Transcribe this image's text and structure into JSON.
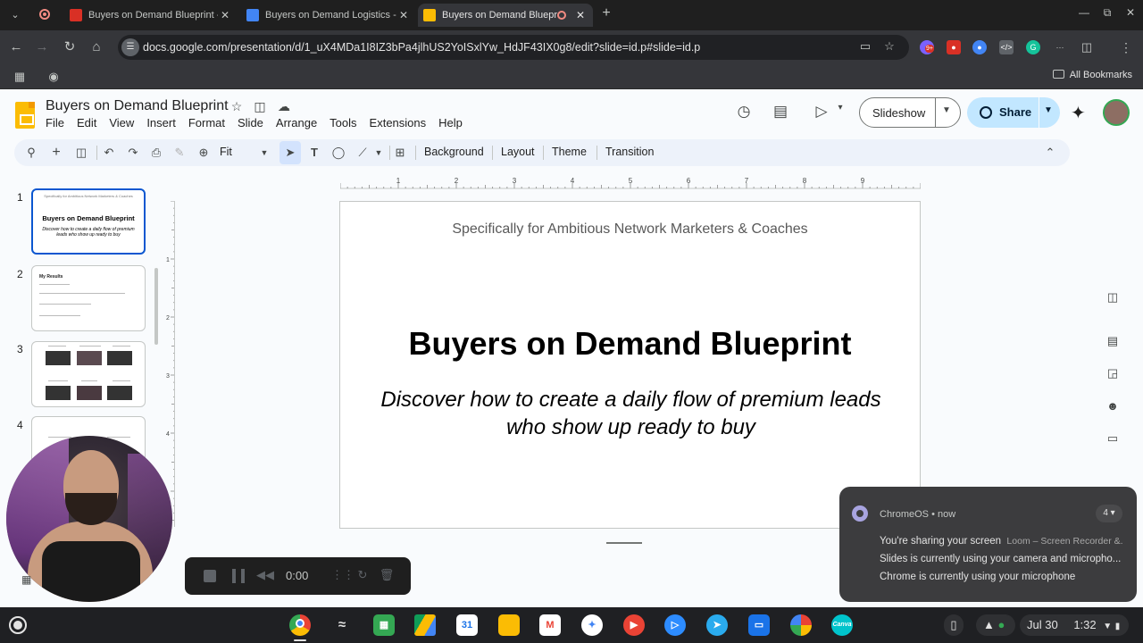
{
  "browser": {
    "tabs": [
      {
        "title": "Buyers on Demand Blueprint - G",
        "active": false
      },
      {
        "title": "Buyers on Demand Logistics - G",
        "active": false
      },
      {
        "title": "Buyers on Demand Blueprint",
        "active": true
      }
    ],
    "url": "docs.google.com/presentation/d/1_uX4MDa1I8IZ3bPa4jlhUS2YoISxlYw_HdJF43IX0g8/edit?slide=id.p#slide=id.p",
    "all_bookmarks": "All Bookmarks",
    "ext_badge": "9+"
  },
  "app": {
    "title": "Buyers on Demand Blueprint",
    "menu": [
      "File",
      "Edit",
      "View",
      "Insert",
      "Format",
      "Slide",
      "Arrange",
      "Tools",
      "Extensions",
      "Help"
    ],
    "slideshow_label": "Slideshow",
    "share_label": "Share",
    "toolbar": {
      "zoom": "Fit",
      "background": "Background",
      "layout": "Layout",
      "theme": "Theme",
      "transition": "Transition"
    }
  },
  "filmstrip": {
    "numbers": [
      "1",
      "2",
      "3",
      "4"
    ],
    "thumb1": {
      "sub": "Specifically for Ambitious Network Marketers & Coaches",
      "title": "Buyers on Demand Blueprint",
      "desc": "Discover how to create a daily flow of premium leads who show up ready to buy"
    },
    "thumb2": {
      "title": "My Results"
    }
  },
  "ruler": {
    "top": [
      "1",
      "2",
      "3",
      "4",
      "5",
      "6",
      "7",
      "8",
      "9"
    ],
    "left": [
      "1",
      "2",
      "3",
      "4"
    ]
  },
  "slide": {
    "subtitle": "Specifically for Ambitious Network Marketers & Coaches",
    "title": "Buyers on Demand Blueprint",
    "desc_line1": "Discover how to create a daily flow of premium leads",
    "desc_line2": "who show up ready to buy"
  },
  "loom": {
    "time": "0:00"
  },
  "notification": {
    "source": "ChromeOS",
    "when": "now",
    "count": "4",
    "line1": "You're sharing your screen",
    "line1_detail": "Loom – Screen Recorder &...",
    "line2": "Slides is currently using your camera and micropho...",
    "line3": "Chrome is currently using your microphone"
  },
  "shelf": {
    "date": "Jul 30",
    "time": "1:32",
    "calendar_day": "31",
    "canva": "Canva"
  },
  "colors": {
    "accent_blue": "#0b57d0",
    "share_bg": "#c2e7ff",
    "slides_yellow": "#fbbc04"
  }
}
